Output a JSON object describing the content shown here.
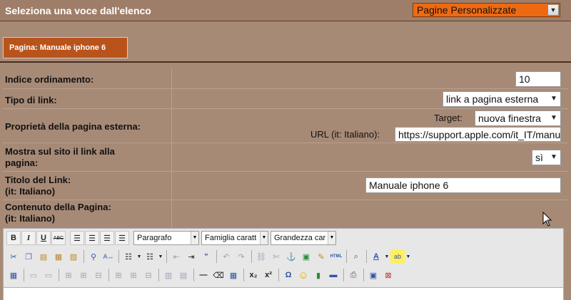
{
  "header": {
    "title": "Seleziona una voce dall'elenco",
    "select_value": "Pagine Personalizzate"
  },
  "page_tab": "Pagina: Manuale iphone 6",
  "form": {
    "sort_index": {
      "label": "Indice ordinamento:",
      "value": "10"
    },
    "link_type": {
      "label": "Tipo di link:",
      "value": "link a pagina esterna"
    },
    "external": {
      "label": "Proprietà della pagina esterna:",
      "target_label": "Target:",
      "target_value": "nuova finestra",
      "url_label": "URL (it: Italiano):",
      "url_value": "https://support.apple.com/it_IT/manu"
    },
    "show_link": {
      "label_line1": "Mostra sul sito il link alla",
      "label_line2": "pagina:",
      "value": "sì"
    },
    "link_title": {
      "label_line1": "Titolo del Link:",
      "label_line2": "(it: Italiano)",
      "value": "Manuale iphone 6"
    },
    "page_content": {
      "label_line1": "Contenuto della Pagina:",
      "label_line2": "(it: Italiano)"
    }
  },
  "editor": {
    "format_combo": "Paragrafo",
    "font_combo": "Famiglia caratt",
    "size_combo": "Grandezza car",
    "abc_label": "ABC",
    "html_label": "HTML"
  },
  "colors": {
    "background": "#a78a76",
    "topbar": "#9f7e69",
    "accent_select": "#ee6a12",
    "page_tab": "#b8531b"
  }
}
